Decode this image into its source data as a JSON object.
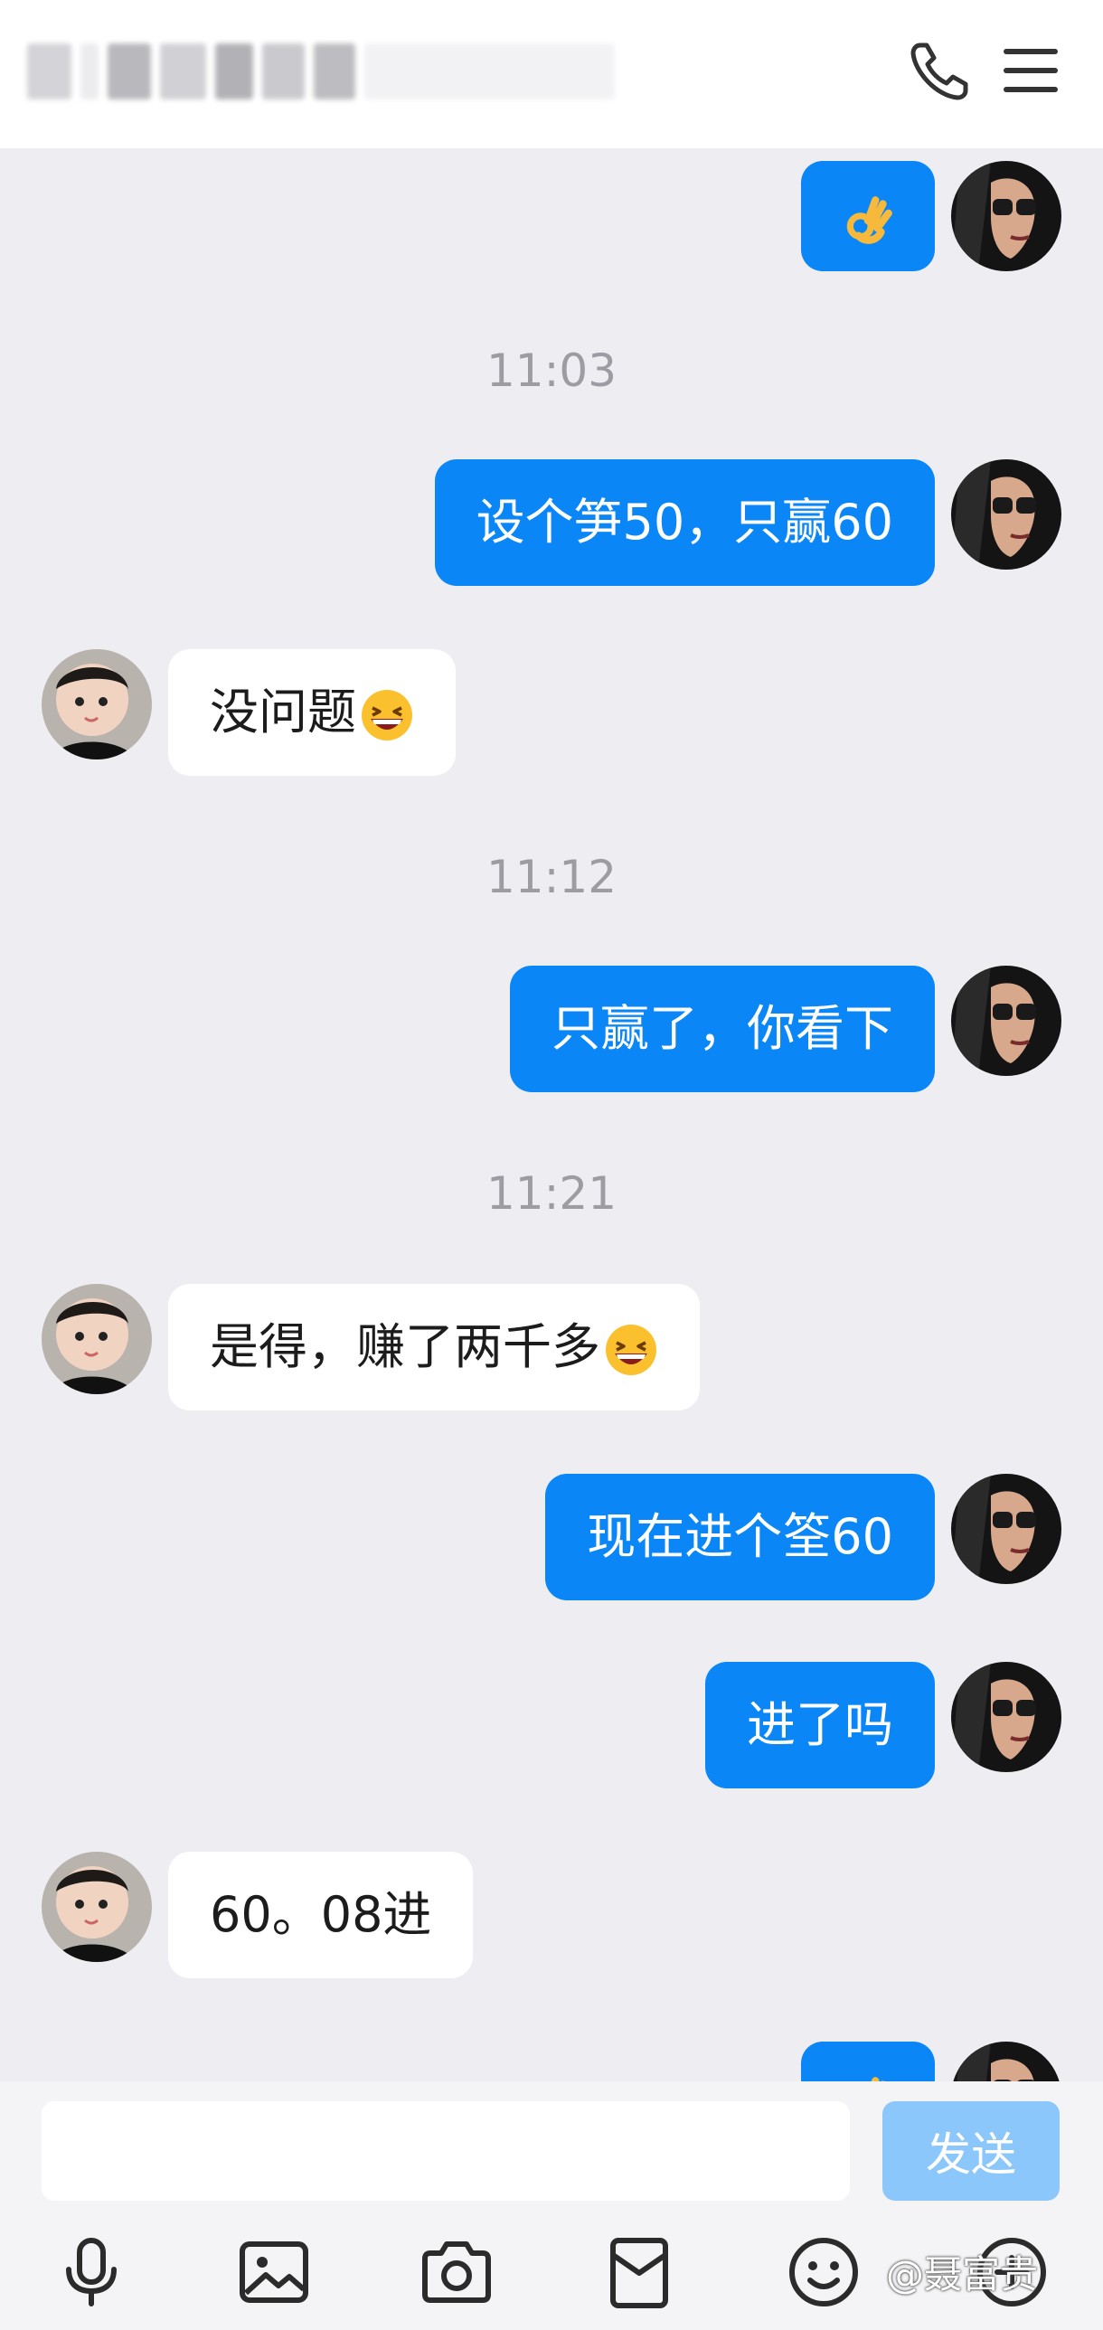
{
  "header": {
    "contact_name": "",
    "icons": {
      "call": "phone-icon",
      "menu": "menu-icon"
    }
  },
  "messages": [
    {
      "kind": "msg",
      "from": "me",
      "emoji": "ok-hand-emoji",
      "text": ""
    },
    {
      "kind": "time",
      "text": "11:03"
    },
    {
      "kind": "msg",
      "from": "me",
      "text": "设个笋50，只赢60"
    },
    {
      "kind": "msg",
      "from": "peer",
      "text": "没问题",
      "emoji": "grinning-squint-emoji"
    },
    {
      "kind": "time",
      "text": "11:12"
    },
    {
      "kind": "msg",
      "from": "me",
      "text": "只赢了，你看下"
    },
    {
      "kind": "time",
      "text": "11:21"
    },
    {
      "kind": "msg",
      "from": "peer",
      "text": "是得，赚了两千多",
      "emoji": "grinning-squint-emoji"
    },
    {
      "kind": "msg",
      "from": "me",
      "text": "现在进个筌60"
    },
    {
      "kind": "msg",
      "from": "me",
      "text": "进了吗"
    },
    {
      "kind": "msg",
      "from": "peer",
      "text": "60。08进"
    },
    {
      "kind": "msg",
      "from": "me",
      "emoji": "ok-hand-emoji",
      "text": ""
    }
  ],
  "input": {
    "value": "",
    "placeholder": ""
  },
  "send_label": "发送",
  "toolbar": [
    "mic-icon",
    "image-icon",
    "camera-icon",
    "red-packet-icon",
    "emoji-icon",
    "plus-icon"
  ],
  "watermark": "@聂富贵",
  "colors": {
    "my_bubble": "#0a86f7",
    "peer_bubble": "#ffffff",
    "background": "#ededf2",
    "send_button": "#8cc7fb",
    "timestamp": "#9c9ca2"
  }
}
